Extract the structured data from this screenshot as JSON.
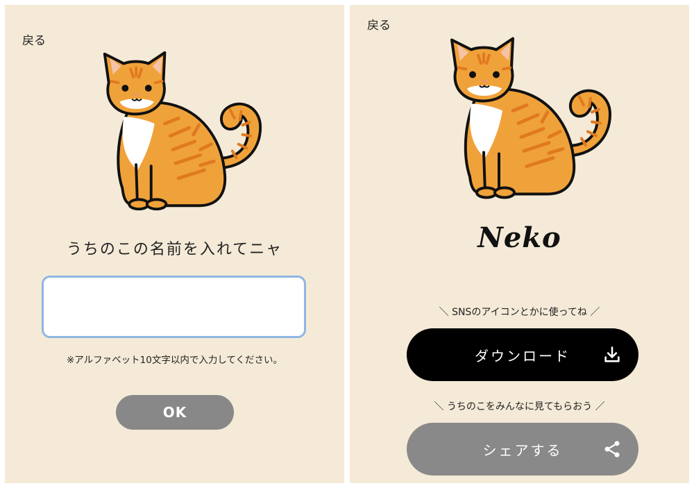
{
  "left": {
    "back_label": "戻る",
    "prompt": "うちのこの名前を入れてニャ",
    "name_input": {
      "value": "",
      "placeholder": ""
    },
    "note": "※アルファベット10文字以内で入力してください。",
    "ok_label": "OK"
  },
  "right": {
    "back_label": "戻る",
    "cat_name": "Neko",
    "caption_download": "＼ SNSのアイコンとかに使ってね ／",
    "download_label": "ダウンロード",
    "caption_share": "＼ うちのこをみんなに見てもらおう ／",
    "share_label": "シェアする"
  },
  "colors": {
    "background": "#f4ead7",
    "input_border": "#8fb6e3",
    "ok_button": "#888888",
    "download_button": "#000000",
    "share_button": "#898989",
    "cat_orange": "#f0a23a",
    "cat_stripe": "#e07a1f"
  },
  "icons": {
    "download": "download-icon",
    "share": "share-icon"
  }
}
